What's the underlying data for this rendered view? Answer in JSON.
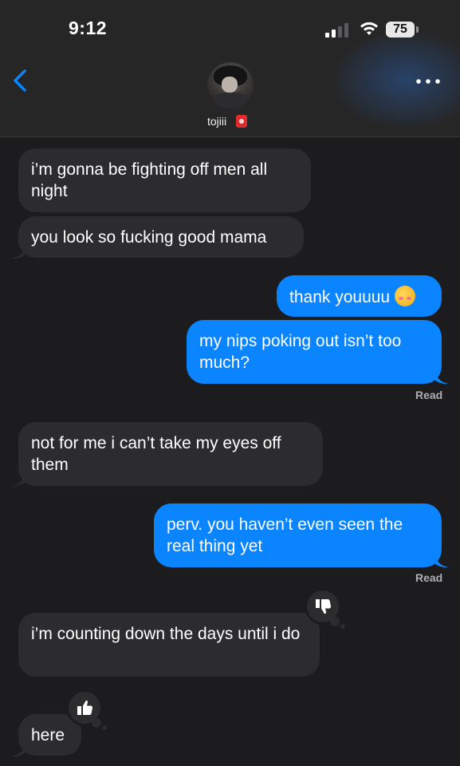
{
  "status_bar": {
    "time": "9:12",
    "battery": "75"
  },
  "header": {
    "contact_name": "tojiii"
  },
  "icons": {
    "back": "chevron-left-icon",
    "more": "more-horizontal-icon",
    "thumbs_down": "thumbs-down-icon",
    "thumbs_up": "thumbs-up-icon",
    "emoji": "smiling-face-with-hearts"
  },
  "colors": {
    "incoming": "#2c2c2e",
    "outgoing": "#0a84ff",
    "accent": "#0a84ff"
  },
  "messages": [
    {
      "from": "them",
      "text": "i’m gonna be fighting off men all night"
    },
    {
      "from": "them",
      "text": "you look so fucking good mama"
    },
    {
      "from": "me",
      "text": "thank youuuu"
    },
    {
      "from": "me",
      "text": "my nips poking out isn’t too much?"
    },
    {
      "from": "them",
      "text": "not for me i can’t take my eyes off them"
    },
    {
      "from": "me",
      "text": "perv. you haven’t even seen the real thing yet"
    },
    {
      "from": "them",
      "text": "i’m counting down the days until i do"
    },
    {
      "from": "them",
      "text": "here"
    }
  ],
  "read_receipts": [
    "Read",
    "Read"
  ]
}
